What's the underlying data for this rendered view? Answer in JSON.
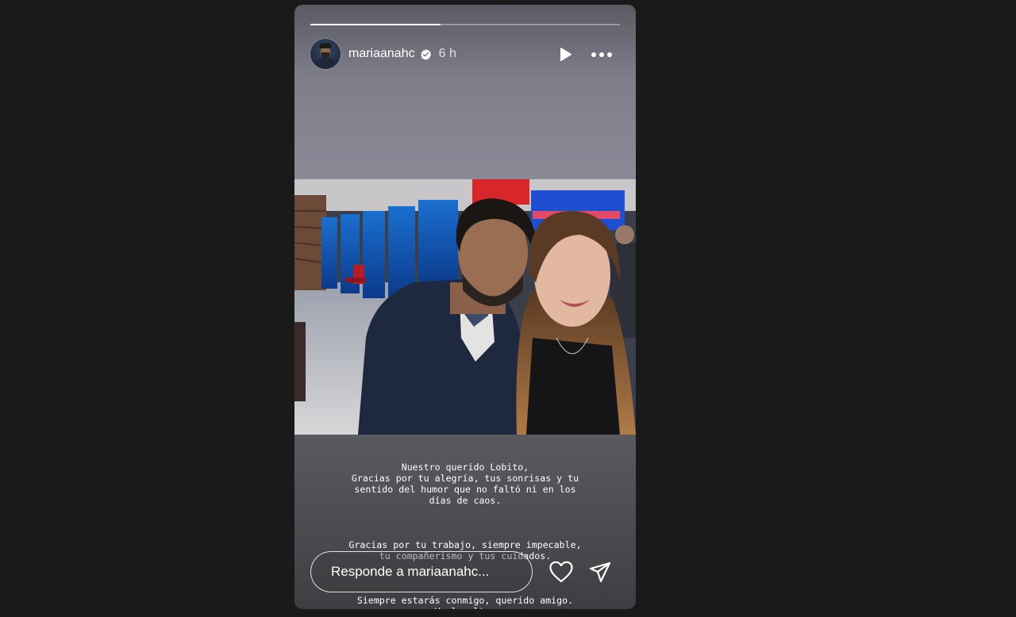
{
  "story": {
    "progress": 0.42,
    "username": "mariaanahc",
    "verified": true,
    "time_ago": "6 h",
    "icons": {
      "play": "play-icon",
      "more": "more-horizontal-icon",
      "verified": "verified-badge-icon",
      "like": "heart-icon",
      "share": "send-icon"
    }
  },
  "caption": {
    "paragraph_1": "Nuestro querido Lobito,\nGracias por tu alegría, tus sonrisas y tu\nsentido del humor que no faltó ni en los\ndías de caos.",
    "paragraph_2": "Gracias por tu trabajo, siempre impecable,\ntu compañerismo y tus cuidados.",
    "paragraph_3": "Siempre estarás conmigo, querido amigo.\nVuela alto."
  },
  "reply": {
    "placeholder": "Responde a mariaanahc..."
  },
  "colors": {
    "background": "#1a1a1a",
    "text": "#ffffff",
    "verified": "#ffffff"
  }
}
